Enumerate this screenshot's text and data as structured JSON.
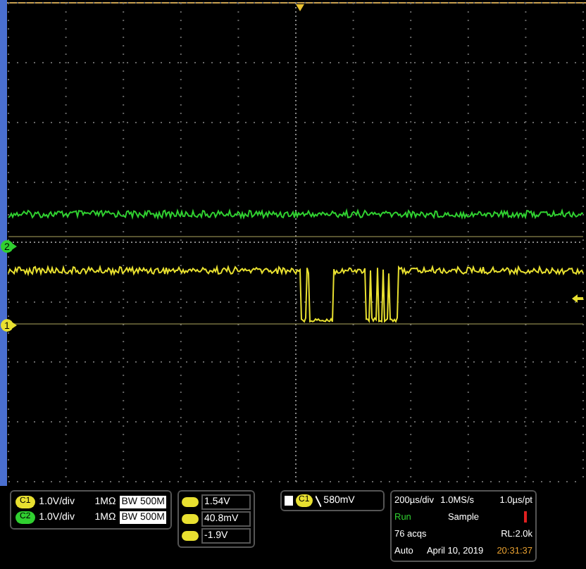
{
  "markers": [
    {
      "label": "2",
      "color": "#30d030"
    },
    {
      "label": "1",
      "color": "#e8e030"
    }
  ],
  "channels": [
    {
      "label": "C1",
      "color": "#e8e030",
      "scale": "1.0V/div",
      "impedance": "1MΩ",
      "bandwidth_prefix": "BW",
      "bandwidth": "500M"
    },
    {
      "label": "C2",
      "color": "#30d030",
      "scale": "1.0V/div",
      "impedance": "1MΩ",
      "bandwidth_prefix": "BW",
      "bandwidth": "500M"
    }
  ],
  "measurements": [
    "1.54V",
    "40.8mV",
    "-1.9V"
  ],
  "trigger": {
    "source": "C1",
    "level": "580mV"
  },
  "acquisition": {
    "timebase": "200µs/div",
    "sample_rate": "1.0MS/s",
    "resolution": "1.0µs/pt",
    "state": "Run",
    "mode": "Sample",
    "count": "76 acqs",
    "record_length": "RL:2.0k",
    "trigger_mode": "Auto",
    "date": "April 10, 2019",
    "time": "20:31:37"
  }
}
